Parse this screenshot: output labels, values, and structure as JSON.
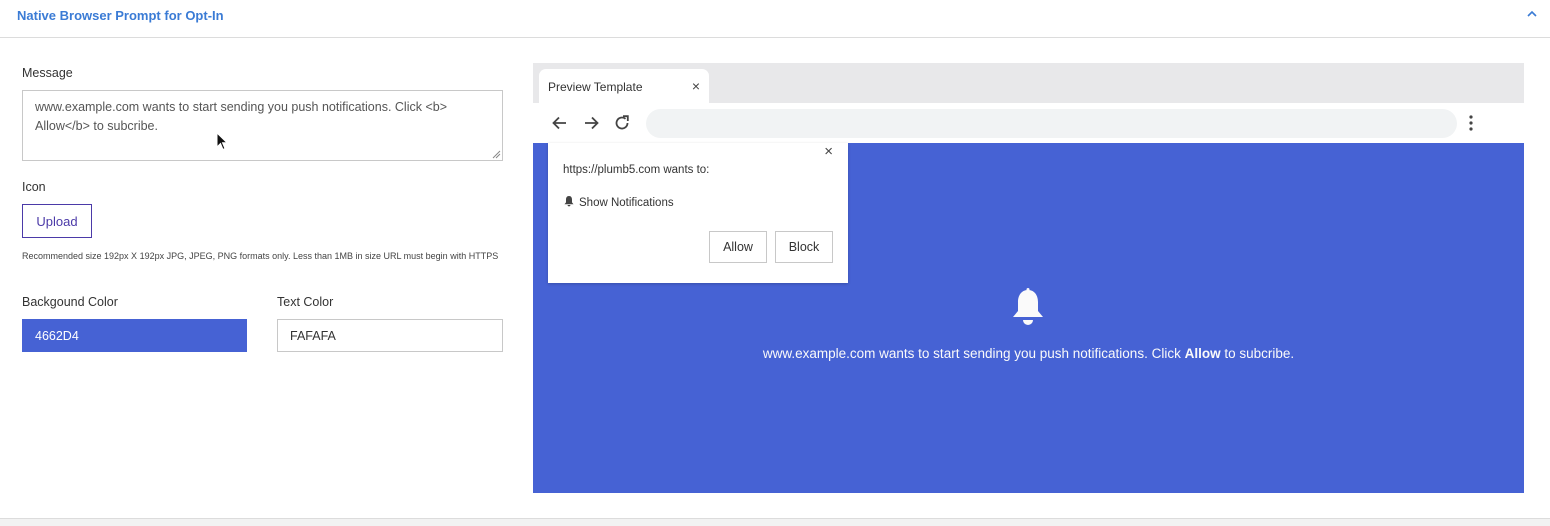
{
  "panel": {
    "title": "Native Browser Prompt for Opt-In"
  },
  "form": {
    "message_label": "Message",
    "message_value": "www.example.com wants to start sending you push notifications. Click <b> Allow</b> to subcribe.",
    "icon_label": "Icon",
    "upload_label": "Upload",
    "hint": "Recommended size 192px X 192px JPG, JPEG, PNG formats only. Less than 1MB in size URL must begin with HTTPS",
    "bg_color_label": "Backgound Color",
    "bg_color_value": "4662D4",
    "text_color_label": "Text Color",
    "text_color_value": "FAFAFA"
  },
  "preview": {
    "tab_title": "Preview Template",
    "tab_close": "×",
    "prompt": {
      "close": "×",
      "origin": "https://plumb5.com wants to:",
      "permission": "Show Notifications",
      "allow": "Allow",
      "block": "Block"
    },
    "message_prefix": "www.example.com wants to start sending you push notifications. Click ",
    "message_bold": "Allow",
    "message_suffix": " to subcribe."
  },
  "colors": {
    "accent": "#3a7bd5",
    "upload": "#4b3aa8",
    "background": "#4662D4",
    "text": "#FAFAFA"
  },
  "icons": [
    "chevron-up-icon",
    "cursor-icon",
    "back-arrow-icon",
    "forward-arrow-icon",
    "reload-icon",
    "kebab-menu-icon",
    "bell-icon"
  ]
}
